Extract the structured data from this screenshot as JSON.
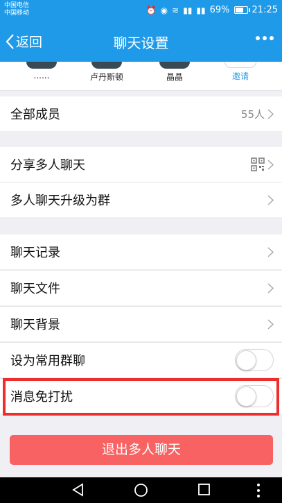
{
  "status_bar": {
    "carrier_line1": "中国电信",
    "carrier_line2": "中国移动",
    "battery_percent": "69%",
    "time": "21:25"
  },
  "header": {
    "back_label": "返回",
    "title": "聊天设置"
  },
  "members": [
    {
      "name": "......"
    },
    {
      "name": "卢丹斯顿"
    },
    {
      "name": "晶晶"
    },
    {
      "name": "邀请"
    }
  ],
  "rows": {
    "all_members": {
      "label": "全部成员",
      "value": "55人"
    },
    "share": {
      "label": "分享多人聊天"
    },
    "upgrade": {
      "label": "多人聊天升级为群"
    },
    "history": {
      "label": "聊天记录"
    },
    "files": {
      "label": "聊天文件"
    },
    "background": {
      "label": "聊天背景"
    },
    "frequent": {
      "label": "设为常用群聊",
      "on": false
    },
    "mute": {
      "label": "消息免打扰",
      "on": false
    }
  },
  "exit_button": {
    "label": "退出多人聊天"
  },
  "colors": {
    "primary": "#1f9ae8",
    "danger": "#f96262",
    "highlight": "#ee2d2d",
    "background": "#efeff4"
  }
}
